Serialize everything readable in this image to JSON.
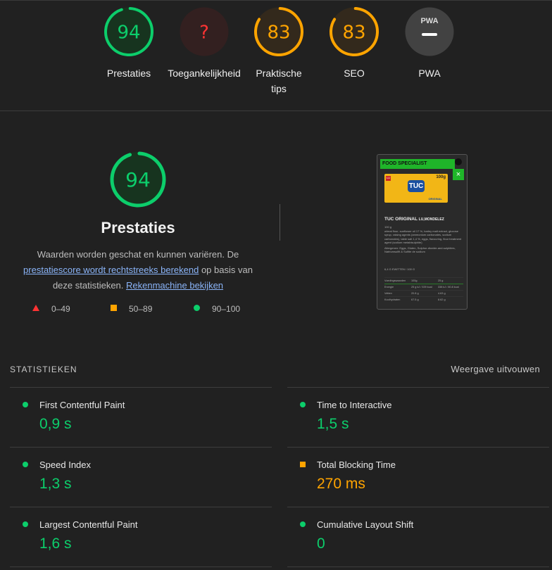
{
  "categories": [
    {
      "label": "Prestaties",
      "score": "94",
      "color": "#0cce6b",
      "bg": "#17341f",
      "fill": 0.94
    },
    {
      "label": "Toegankelijkheid",
      "score": "?",
      "color": "#ff3333",
      "bg": "#332020",
      "fill": 0
    },
    {
      "label": "Praktische tips",
      "score": "83",
      "color": "#ffa400",
      "bg": "#33291c",
      "fill": 0.83
    },
    {
      "label": "SEO",
      "score": "83",
      "color": "#ffa400",
      "bg": "#33291c",
      "fill": 0.83
    },
    {
      "label": "PWA",
      "badge": "PWA",
      "score": "—",
      "color": "#ffffff",
      "bg": "#424242",
      "fill": 0
    }
  ],
  "performance": {
    "score": "94",
    "title": "Prestaties",
    "desc_1": "Waarden worden geschat en kunnen variëren. De ",
    "link_1": "prestatiescore wordt rechtstreeks berekend",
    "desc_2": " op basis van deze statistieken. ",
    "link_2": "Rekenmachine bekijken"
  },
  "legend": [
    {
      "range": "0–49"
    },
    {
      "range": "50–89"
    },
    {
      "range": "90–100"
    }
  ],
  "screenshot": {
    "banner": "FOOD SPECIALIST",
    "product": "TUC ORIGINAL",
    "brand": "LU,MONDELEZ",
    "weight": "100 g",
    "pack_size": "100g",
    "pack_brand": "TUC",
    "pack_sub": "ORIGINAL",
    "ingredients": "wheat flour, sunflower oil 17 %, barley malt extract, glucose syrup, raising agents (ammonium carbonates, sodium carbonates), table salt 1,4 %, eggs, flavouring, flour treatment agent (sodium metabisulphite)",
    "allergens": "Allergenen: Eggs, Gluten, Sulphur-dioxide-and-sulphites, Natriumsulfit & Sulfite de sodium",
    "points": "6,4 G EWITTEN / 100 G",
    "table": [
      [
        "Voedingswaarden",
        "100g",
        "25 g"
      ],
      [
        "Energie",
        "25 g kJ / 539 kcal",
        "338 kJ / 80.8 kcal"
      ],
      [
        "Vetten",
        "20.8 g",
        "4.63 g"
      ],
      [
        "Koolhydraten",
        "67.5 g",
        "8.62 g"
      ]
    ]
  },
  "stats": {
    "heading": "STATISTIEKEN",
    "expand": "Weergave uitvouwen",
    "items": [
      {
        "name": "First Contentful Paint",
        "value": "0,9 s",
        "status": "pass"
      },
      {
        "name": "Time to Interactive",
        "value": "1,5 s",
        "status": "pass"
      },
      {
        "name": "Speed Index",
        "value": "1,3 s",
        "status": "pass"
      },
      {
        "name": "Total Blocking Time",
        "value": "270 ms",
        "status": "average"
      },
      {
        "name": "Largest Contentful Paint",
        "value": "1,6 s",
        "status": "pass"
      },
      {
        "name": "Cumulative Layout Shift",
        "value": "0",
        "status": "pass"
      }
    ]
  },
  "colors": {
    "pass": "#0cce6b",
    "average": "#ffa400",
    "fail": "#ff3333"
  }
}
